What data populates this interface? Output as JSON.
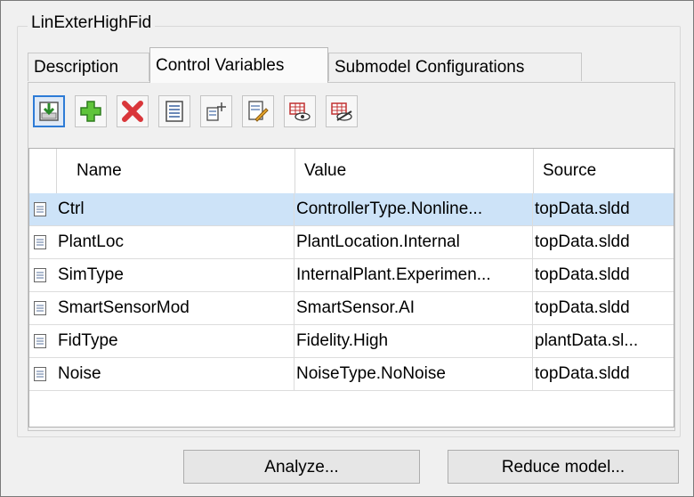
{
  "group": {
    "title": "LinExterHighFid"
  },
  "tabs": [
    {
      "label": "Description",
      "active": false
    },
    {
      "label": "Control Variables",
      "active": true
    },
    {
      "label": "Submodel Configurations",
      "active": false
    }
  ],
  "toolbar": [
    {
      "icon": "import-icon",
      "pressed": true
    },
    {
      "icon": "add-icon",
      "pressed": false
    },
    {
      "icon": "delete-icon",
      "pressed": false
    },
    {
      "icon": "variable-icon",
      "pressed": false
    },
    {
      "icon": "add-variable-icon",
      "pressed": false
    },
    {
      "icon": "edit-variable-icon",
      "pressed": false
    },
    {
      "icon": "show-table-icon",
      "pressed": false
    },
    {
      "icon": "hide-table-icon",
      "pressed": false
    }
  ],
  "table": {
    "columns": [
      "Name",
      "Value",
      "Source"
    ],
    "rows": [
      {
        "name": "Ctrl",
        "value": "ControllerType.Nonline...",
        "source": "topData.sldd",
        "selected": true
      },
      {
        "name": "PlantLoc",
        "value": "PlantLocation.Internal",
        "source": "topData.sldd",
        "selected": false
      },
      {
        "name": "SimType",
        "value": "InternalPlant.Experimen...",
        "source": "topData.sldd",
        "selected": false
      },
      {
        "name": "SmartSensorMod",
        "value": "SmartSensor.AI",
        "source": "topData.sldd",
        "selected": false
      },
      {
        "name": "FidType",
        "value": "Fidelity.High",
        "source": "plantData.sl...",
        "selected": false
      },
      {
        "name": "Noise",
        "value": "NoiseType.NoNoise",
        "source": "topData.sldd",
        "selected": false
      }
    ]
  },
  "buttons": {
    "analyze": "Analyze...",
    "reduce": "Reduce model..."
  }
}
